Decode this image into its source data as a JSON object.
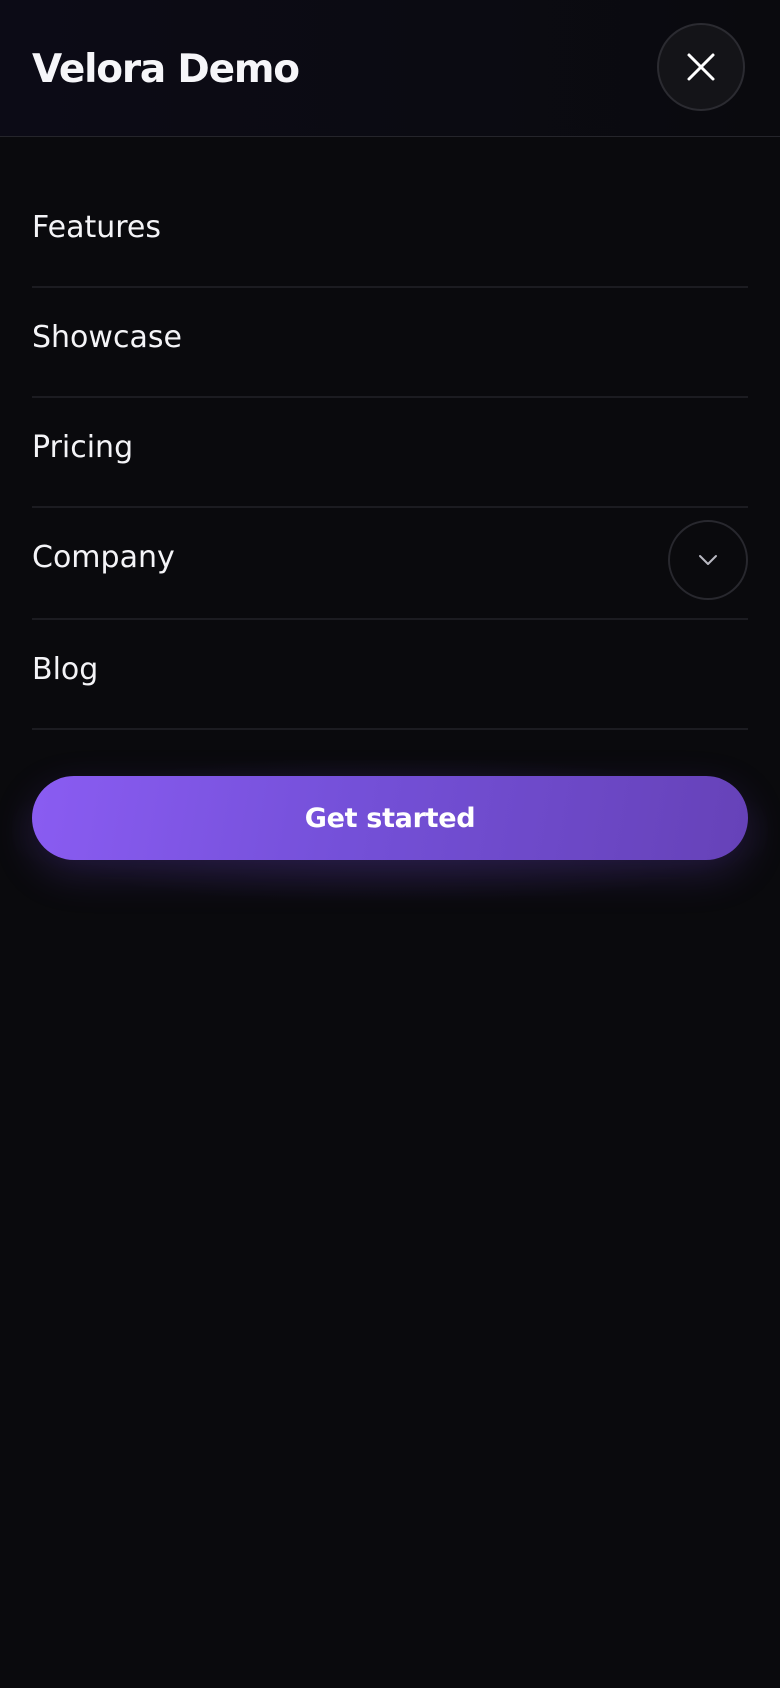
{
  "header": {
    "brand": "Velora Demo",
    "close_icon": "close-icon"
  },
  "nav": {
    "items": [
      {
        "label": "Features"
      },
      {
        "label": "Showcase"
      },
      {
        "label": "Pricing"
      },
      {
        "label": "Company",
        "expand_icon": "chevron-down-icon"
      },
      {
        "label": "Blog"
      }
    ]
  },
  "cta": {
    "label": "Get started"
  },
  "colors": {
    "background": "#0a0a0d",
    "accent_start": "#8a5cf2",
    "accent_end": "#6642b8",
    "text": "#f4f4f7",
    "divider": "#1c1c21"
  }
}
